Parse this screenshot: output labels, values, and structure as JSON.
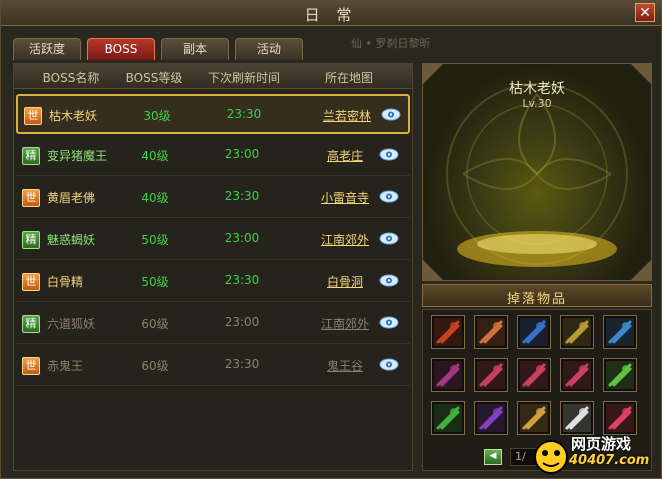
{
  "window": {
    "title": "日 常",
    "close_label": "✕"
  },
  "tabs": [
    {
      "label": "活跃度",
      "active": false
    },
    {
      "label": "BOSS",
      "active": true
    },
    {
      "label": "副本",
      "active": false
    },
    {
      "label": "活动",
      "active": false
    }
  ],
  "tab_bar_extra": "仙 • 罗刹日黎昕",
  "table": {
    "headers": [
      "BOSS名称",
      "BOSS等级",
      "下次刷新时间",
      "所在地图"
    ],
    "rows": [
      {
        "badge": "世",
        "badge_type": "world",
        "name": "枯木老妖",
        "level": "30级",
        "time": "23:30",
        "map": "兰若密林",
        "active": true,
        "selected": true
      },
      {
        "badge": "精",
        "badge_type": "elite",
        "name": "变异猪魔王",
        "level": "40级",
        "time": "23:00",
        "map": "高老庄",
        "active": true,
        "selected": false
      },
      {
        "badge": "世",
        "badge_type": "world",
        "name": "黄眉老佛",
        "level": "40级",
        "time": "23:30",
        "map": "小雷音寺",
        "active": true,
        "selected": false
      },
      {
        "badge": "精",
        "badge_type": "elite",
        "name": "魅惑蝎妖",
        "level": "50级",
        "time": "23:00",
        "map": "江南郊外",
        "active": true,
        "selected": false
      },
      {
        "badge": "世",
        "badge_type": "world",
        "name": "白骨精",
        "level": "50级",
        "time": "23:30",
        "map": "白骨洞",
        "active": true,
        "selected": false
      },
      {
        "badge": "精",
        "badge_type": "elite",
        "name": "六道狐妖",
        "level": "60级",
        "time": "23:00",
        "map": "江南郊外",
        "active": false,
        "selected": false
      },
      {
        "badge": "世",
        "badge_type": "world",
        "name": "赤鬼王",
        "level": "60级",
        "time": "23:30",
        "map": "鬼王谷",
        "active": false,
        "selected": false
      }
    ]
  },
  "preview": {
    "boss_name": "枯木老妖",
    "boss_level": "Lv.30"
  },
  "drops": {
    "title": "掉落物品",
    "items": [
      {
        "icon": "axe-weapon-icon",
        "color": "#c84020"
      },
      {
        "icon": "halberd-weapon-icon",
        "color": "#d0703a"
      },
      {
        "icon": "fan-weapon-icon",
        "color": "#3a70c8"
      },
      {
        "icon": "spear-weapon-icon",
        "color": "#b89a30"
      },
      {
        "icon": "staff-weapon-icon",
        "color": "#3a8ad0"
      },
      {
        "icon": "chain-weapon-icon",
        "color": "#a03a80"
      },
      {
        "icon": "necklace-icon",
        "color": "#c84060"
      },
      {
        "icon": "necklace-icon",
        "color": "#c84060"
      },
      {
        "icon": "necklace-icon",
        "color": "#c84060"
      },
      {
        "icon": "ring-icon",
        "color": "#60c040"
      },
      {
        "icon": "jade-bracelet-icon",
        "color": "#40b040"
      },
      {
        "icon": "crystal-icon",
        "color": "#8040c0"
      },
      {
        "icon": "gem-pile-icon",
        "color": "#d0a040"
      },
      {
        "icon": "dice-icon",
        "color": "#e0e0e0"
      },
      {
        "icon": "red-crystal-icon",
        "color": "#e04060"
      }
    ]
  },
  "pager": {
    "page_text": "1/"
  },
  "watermark": {
    "line1": "网页游戏",
    "line2": "40407.com"
  },
  "colors": {
    "level_active": "#39d24a",
    "time_active": "#39d24a",
    "map_active": "#f4d57a",
    "name_world": "#f4d57a",
    "name_elite": "#8fe07a",
    "inactive_text": "#8a8070"
  }
}
